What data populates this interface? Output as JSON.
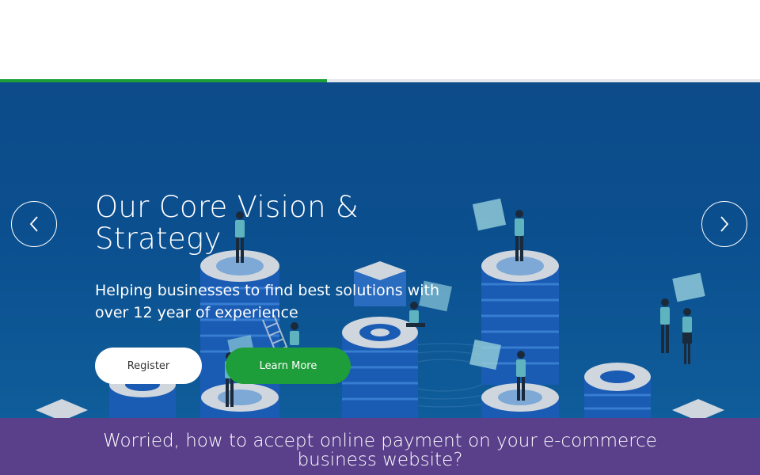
{
  "carousel": {
    "progress_fraction": 0.43,
    "slide": {
      "title": "Our Core Vision & Strategy",
      "subtitle": "Helping businesses to find best solutions with over 12 year of experience",
      "register_label": "Register",
      "learn_more_label": "Learn More"
    },
    "prev_icon": "chevron-left-icon",
    "next_icon": "chevron-right-icon"
  },
  "banner": {
    "text": "Worried, how to accept online payment on your e-commerce business website?"
  },
  "colors": {
    "accent_green": "#1e9e3a",
    "hero_blue": "#0d4b8a",
    "banner_purple": "#5a3f8a"
  }
}
